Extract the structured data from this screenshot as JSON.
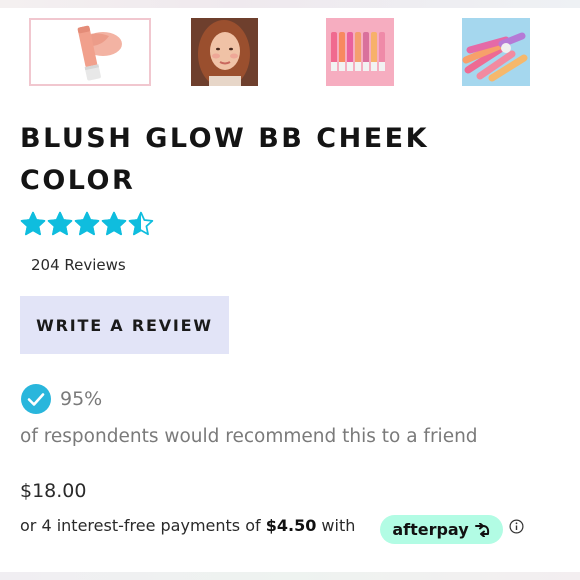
{
  "product": {
    "title": "BLUSH GLOW BB CHEEK COLOR",
    "rating": 4.5,
    "rating_max": 5,
    "reviews_label": "204 Reviews",
    "write_review_label": "WRITE A REVIEW",
    "recommend_percent": "95%",
    "recommend_text": "of respondents would recommend this to a friend",
    "price": "$18.00",
    "installment_prefix": "or 4 interest-free payments of",
    "installment_amount": "$4.50",
    "installment_suffix": "with",
    "afterpay_label": "afterpay",
    "colors": {
      "star": "#0fbdde",
      "check": "#29b6dc",
      "button_bg": "#e2e4f7",
      "afterpay_bg": "#b2fce4"
    }
  },
  "gallery": {
    "thumbnails": [
      {
        "name": "single-tube-product-image",
        "selected": true
      },
      {
        "name": "model-portrait-image",
        "selected": false
      },
      {
        "name": "tubes-lineup-image",
        "selected": false
      },
      {
        "name": "tubes-fan-image",
        "selected": false
      }
    ]
  },
  "icons": {
    "star": "star-icon",
    "check": "check-circle-icon",
    "afterpay_arrows": "afterpay-arrows-icon",
    "info": "info-icon"
  }
}
